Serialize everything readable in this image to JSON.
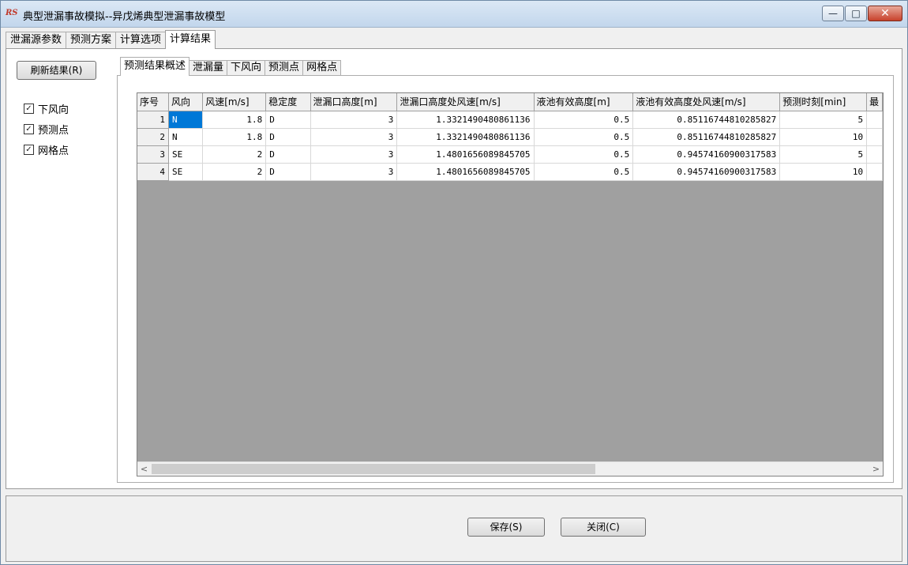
{
  "window": {
    "title": "典型泄漏事故模拟--异戊烯典型泄漏事故模型",
    "app_icon_text": "RS",
    "minimize_glyph": "—",
    "maximize_glyph": "□",
    "close_glyph": "✕"
  },
  "main_tabs": [
    {
      "label": "泄漏源参数"
    },
    {
      "label": "预测方案"
    },
    {
      "label": "计算选项"
    },
    {
      "label": "计算结果",
      "active": true
    }
  ],
  "left_panel": {
    "refresh_label": "刷新结果(R)",
    "checkboxes": [
      {
        "label": "下风向",
        "checked": true
      },
      {
        "label": "预测点",
        "checked": true
      },
      {
        "label": "网格点",
        "checked": true
      }
    ]
  },
  "result_tabs": [
    {
      "label": "预测结果概述",
      "active": true
    },
    {
      "label": "泄漏量"
    },
    {
      "label": "下风向"
    },
    {
      "label": "预测点"
    },
    {
      "label": "网格点"
    }
  ],
  "table": {
    "columns": [
      "序号",
      "风向",
      "风速[m/s]",
      "稳定度",
      "泄漏口高度[m]",
      "泄漏口高度处风速[m/s]",
      "液池有效高度[m]",
      "液池有效高度处风速[m/s]",
      "预测时刻[min]",
      "最"
    ],
    "rows": [
      [
        "1",
        "N",
        "1.8",
        "D",
        "3",
        "1.3321490480861136",
        "0.5",
        "0.85116744810285827",
        "5"
      ],
      [
        "2",
        "N",
        "1.8",
        "D",
        "3",
        "1.3321490480861136",
        "0.5",
        "0.85116744810285827",
        "10"
      ],
      [
        "3",
        "SE",
        "2",
        "D",
        "3",
        "1.4801656089845705",
        "0.5",
        "0.94574160900317583",
        "5"
      ],
      [
        "4",
        "SE",
        "2",
        "D",
        "3",
        "1.4801656089845705",
        "0.5",
        "0.94574160900317583",
        "10"
      ]
    ],
    "selected_cell": {
      "row": 0,
      "col": 1
    }
  },
  "scrollbar": {
    "left_arrow": "<",
    "right_arrow": ">"
  },
  "footer": {
    "save_label": "保存(S)",
    "close_label": "关闭(C)"
  }
}
